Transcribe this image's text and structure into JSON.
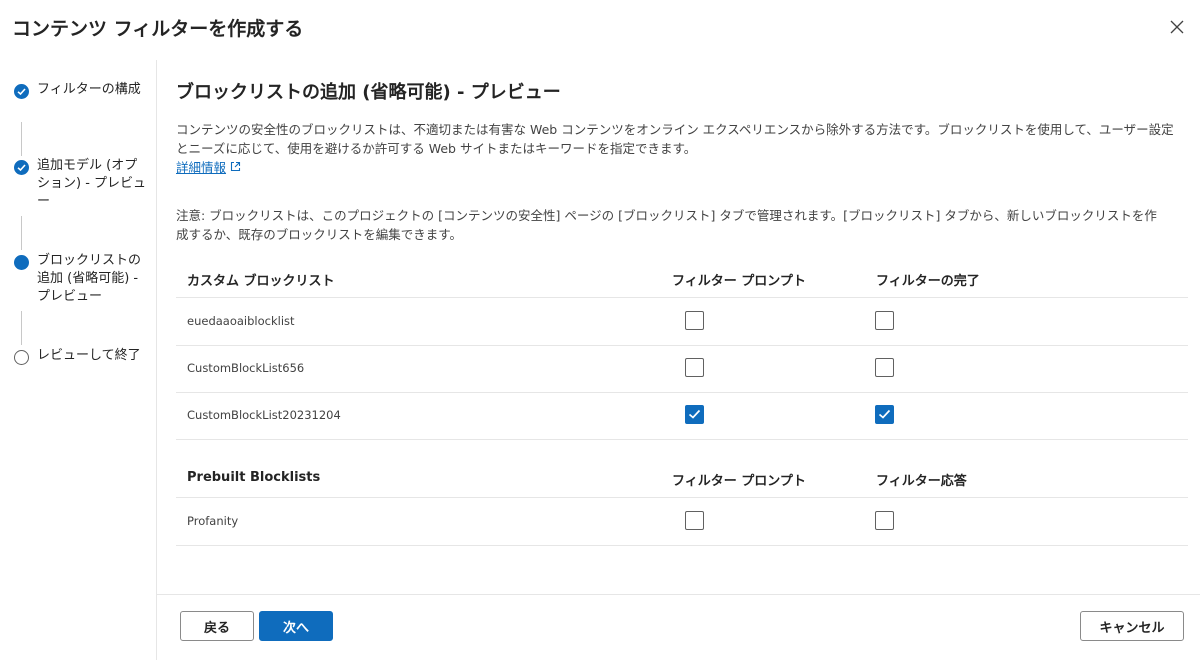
{
  "dialog": {
    "title": "コンテンツ フィルターを作成する"
  },
  "steps": [
    {
      "label": "フィルターの構成",
      "state": "done"
    },
    {
      "label": "追加モデル (オプション) - プレビュー",
      "state": "done"
    },
    {
      "label": "ブロックリストの追加 (省略可能) - プレビュー",
      "state": "current"
    },
    {
      "label": "レビューして終了",
      "state": "pending"
    }
  ],
  "main": {
    "title": "ブロックリストの追加 (省略可能) - プレビュー",
    "description": "コンテンツの安全性のブロックリストは、不適切または有害な Web コンテンツをオンライン エクスペリエンスから除外する方法です。ブロックリストを使用して、ユーザー設定とニーズに応じて、使用を避けるか許可する Web サイトまたはキーワードを指定できます。",
    "learn_more": "詳細情報",
    "note": "注意: ブロックリストは、このプロジェクトの [コンテンツの安全性] ページの [ブロックリスト] タブで管理されます。[ブロックリスト] タブから、新しいブロックリストを作成するか、既存のブロックリストを編集できます。"
  },
  "custom_table": {
    "headers": [
      "カスタム ブロックリスト",
      "フィルター プロンプト",
      "フィルターの完了"
    ],
    "rows": [
      {
        "name": "euedaaoaiblocklist",
        "prompt": false,
        "completion": false
      },
      {
        "name": "CustomBlockList656",
        "prompt": false,
        "completion": false
      },
      {
        "name": "CustomBlockList20231204",
        "prompt": true,
        "completion": true
      }
    ]
  },
  "prebuilt_table": {
    "headers": [
      "Prebuilt Blocklists",
      "フィルター プロンプト",
      "フィルター応答"
    ],
    "rows": [
      {
        "name": "Profanity",
        "prompt": false,
        "completion": false
      }
    ]
  },
  "footer": {
    "back_label": "戻る",
    "next_label": "次へ",
    "cancel_label": "キャンセル"
  },
  "colors": {
    "accent": "#0f6cbd",
    "border": "#e6e6e6"
  }
}
